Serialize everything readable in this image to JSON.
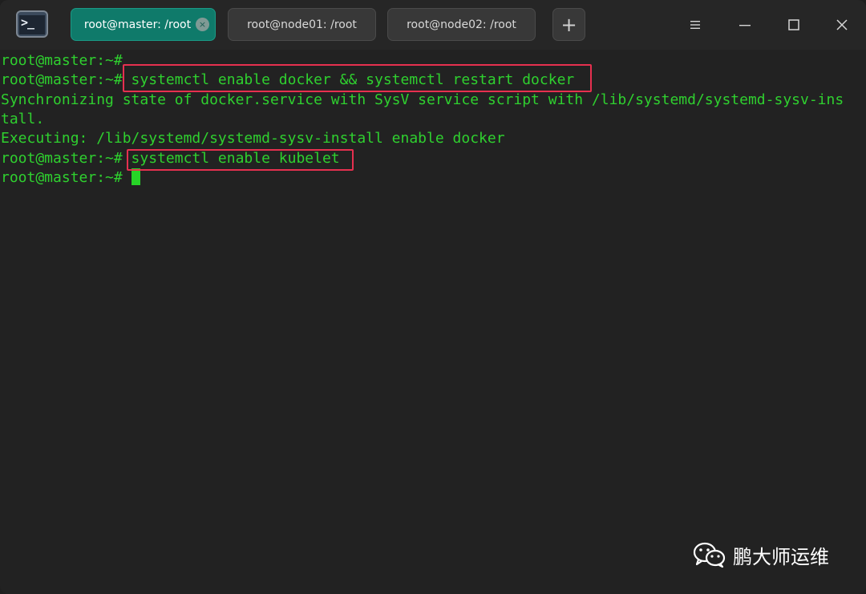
{
  "titlebar": {
    "tabs": [
      {
        "label": "root@master: /root",
        "active": true
      },
      {
        "label": "root@node01: /root",
        "active": false
      },
      {
        "label": "root@node02: /root",
        "active": false
      }
    ],
    "new_tab_symbol": "+",
    "close_tab_symbol": "×",
    "controls": [
      "menu-icon",
      "minimize-icon",
      "maximize-icon",
      "close-icon"
    ]
  },
  "terminal": {
    "lines": [
      "root@master:~#",
      "root@master:~# systemctl enable docker && systemctl restart docker",
      "Synchronizing state of docker.service with SysV service script with /lib/systemd/systemd-sysv-ins",
      "tall.",
      "Executing: /lib/systemd/systemd-sysv-install enable docker",
      "root@master:~# systemctl enable kubelet",
      "root@master:~# "
    ],
    "text_color": "#2fd02f",
    "highlight_color": "#e6304f"
  },
  "watermark": {
    "text": "鹏大师运维",
    "icon": "wechat-icon"
  },
  "colors": {
    "active_tab": "#0f7a6a",
    "background": "#222222"
  }
}
